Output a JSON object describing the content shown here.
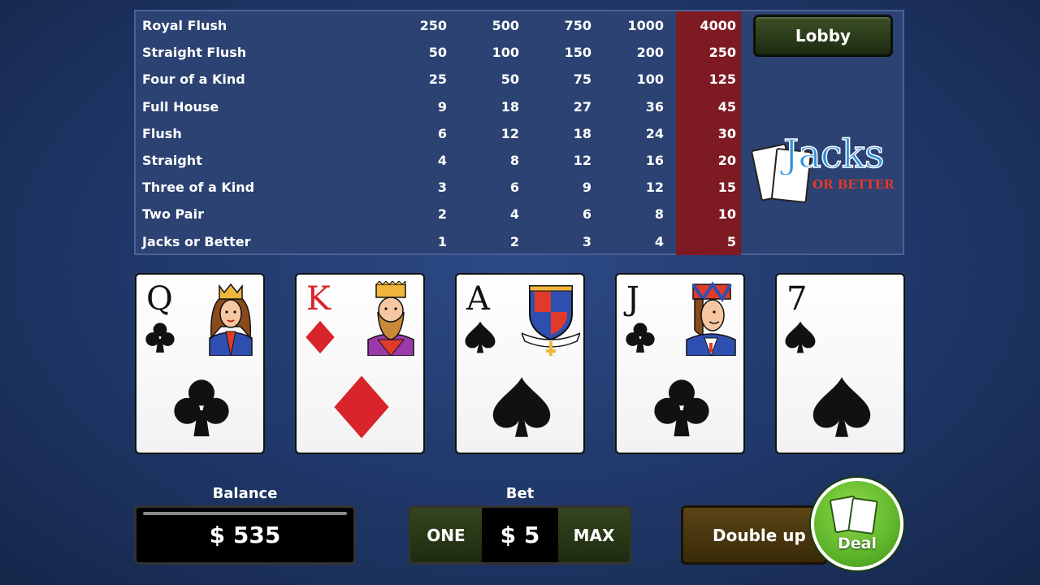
{
  "paytable": {
    "rows": [
      {
        "hand": "Royal Flush",
        "payouts": [
          "250",
          "500",
          "750",
          "1000",
          "4000"
        ]
      },
      {
        "hand": "Straight Flush",
        "payouts": [
          "50",
          "100",
          "150",
          "200",
          "250"
        ]
      },
      {
        "hand": "Four of a Kind",
        "payouts": [
          "25",
          "50",
          "75",
          "100",
          "125"
        ]
      },
      {
        "hand": "Full House",
        "payouts": [
          "9",
          "18",
          "27",
          "36",
          "45"
        ]
      },
      {
        "hand": "Flush",
        "payouts": [
          "6",
          "12",
          "18",
          "24",
          "30"
        ]
      },
      {
        "hand": "Straight",
        "payouts": [
          "4",
          "8",
          "12",
          "16",
          "20"
        ]
      },
      {
        "hand": "Three of a Kind",
        "payouts": [
          "3",
          "6",
          "9",
          "12",
          "15"
        ]
      },
      {
        "hand": "Two Pair",
        "payouts": [
          "2",
          "4",
          "6",
          "8",
          "10"
        ]
      },
      {
        "hand": "Jacks or Better",
        "payouts": [
          "1",
          "2",
          "3",
          "4",
          "5"
        ]
      }
    ],
    "highlight_color": "#7e1a22"
  },
  "header": {
    "lobby_label": "Lobby"
  },
  "logo": {
    "title": "Jacks",
    "subtitle": "OR BETTER"
  },
  "cards": [
    {
      "rank": "Q",
      "suit": "clubs",
      "color": "black",
      "face": "queen"
    },
    {
      "rank": "K",
      "suit": "diamonds",
      "color": "red",
      "face": "king"
    },
    {
      "rank": "A",
      "suit": "spades",
      "color": "black",
      "face": "crest"
    },
    {
      "rank": "J",
      "suit": "clubs",
      "color": "black",
      "face": "jack"
    },
    {
      "rank": "7",
      "suit": "spades",
      "color": "black",
      "face": "none"
    }
  ],
  "controls": {
    "balance_label": "Balance",
    "balance_value": "$ 535",
    "bet_label": "Bet",
    "bet_one_label": "ONE",
    "bet_value": "$ 5",
    "bet_max_label": "MAX",
    "double_up_label": "Double up",
    "deal_label": "Deal"
  }
}
